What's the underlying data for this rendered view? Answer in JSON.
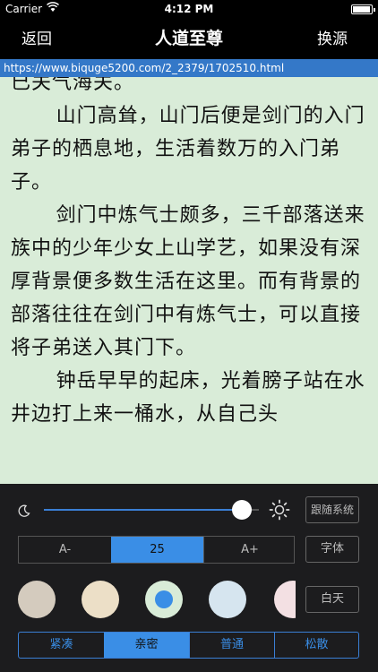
{
  "status_bar": {
    "carrier": "Carrier",
    "time": "4:12 PM"
  },
  "nav": {
    "back_label": "返回",
    "title": "人道至尊",
    "switch_source_label": "换源"
  },
  "url": "https://www.biquge5200.com/2_2379/1702510.html",
  "reader": {
    "background_color": "#d9ecd8",
    "partial_top_line": "已关气海关。",
    "paragraphs": [
      "山门高耸，山门后便是剑门的入门弟子的栖息地，生活着数万的入门弟子。",
      "剑门中炼气士颇多，三千部落送来族中的少年少女上山学艺，如果没有深厚背景便多数生活在这里。而有背景的部落往往在剑门中有炼气士，可以直接将子弟送入其门下。",
      "钟岳早早的起床，光着膀子站在水井边打上来一桶水，从自己头"
    ]
  },
  "settings": {
    "brightness": {
      "level": 0.92,
      "moon_icon": "moon-icon",
      "sun_icon": "sun-icon"
    },
    "follow_system_label": "跟随系统",
    "font_size": {
      "decrease_label": "A-",
      "value": "25",
      "increase_label": "A+"
    },
    "font_label": "字体",
    "themes": [
      {
        "name": "gray",
        "color": "#d4cbbe"
      },
      {
        "name": "beige",
        "color": "#ecdfc7"
      },
      {
        "name": "green",
        "color": "#d9ecd8",
        "selected": true
      },
      {
        "name": "blue",
        "color": "#d6e5ef"
      },
      {
        "name": "pink",
        "color": "#f3e0e3"
      }
    ],
    "day_label": "白天",
    "line_spacing": {
      "options": [
        "紧凑",
        "亲密",
        "普通",
        "松散"
      ],
      "selected": "亲密"
    },
    "accent_color": "#3a8ee6"
  }
}
